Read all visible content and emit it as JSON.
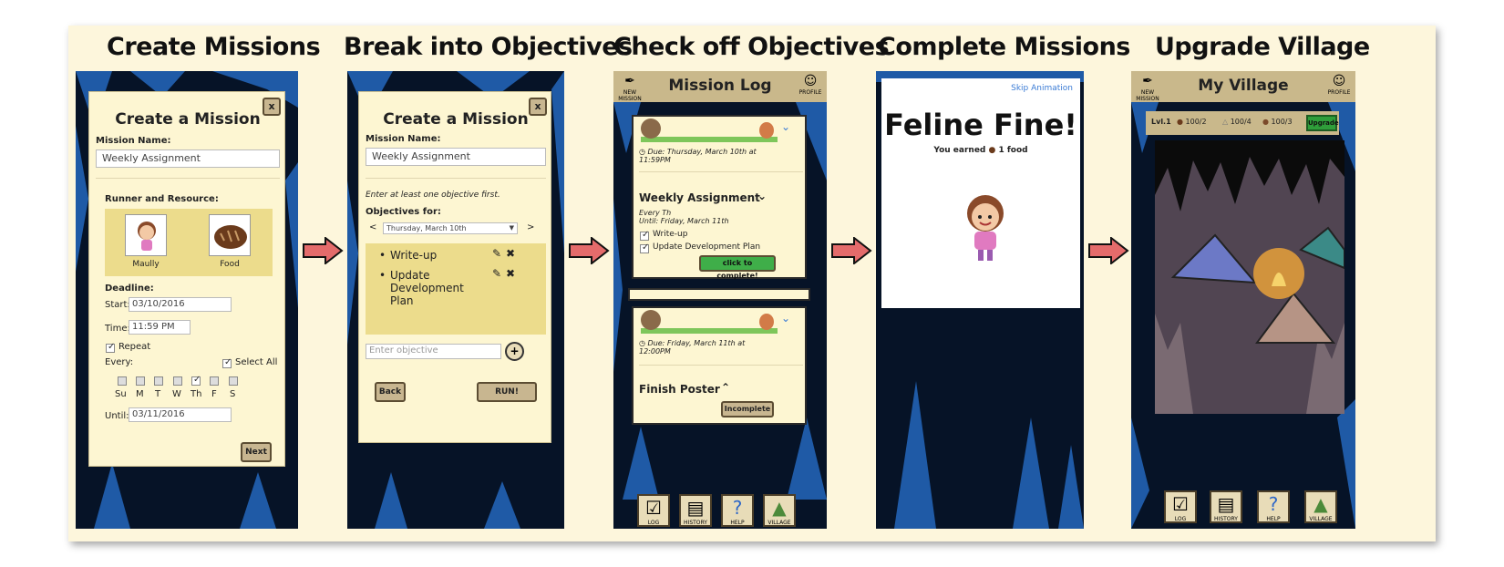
{
  "titles": [
    "Create Missions",
    "Break into Objectives",
    "Check off Objectives",
    "Complete Missions",
    "Upgrade Village"
  ],
  "create": {
    "close": "x",
    "heading": "Create a Mission",
    "mission_name_label": "Mission Name:",
    "mission_name_value": "Weekly Assignment",
    "runner_label": "Runner and Resource:",
    "runner_name": "Maully",
    "resource_name": "Food",
    "deadline_label": "Deadline:",
    "start_label": "Start:",
    "start_value": "03/10/2016",
    "time_label": "Time:",
    "time_value": "11:59 PM",
    "repeat_label": "Repeat",
    "every_label": "Every:",
    "select_all_label": "Select All",
    "days": [
      "Su",
      "M",
      "T",
      "W",
      "Th",
      "F",
      "S"
    ],
    "until_label": "Until:",
    "until_value": "03/11/2016",
    "next_label": "Next"
  },
  "objectives": {
    "close": "x",
    "heading": "Create a Mission",
    "mission_name_label": "Mission Name:",
    "mission_name_value": "Weekly Assignment",
    "hint": "Enter at least one objective first.",
    "objectives_for_label": "Objectives for:",
    "prev": "<",
    "next": ">",
    "date_value": "Thursday, March 10th",
    "items": [
      "Write-up",
      "Update Development Plan"
    ],
    "input_placeholder": "Enter objective",
    "add_label": "+",
    "back_label": "Back",
    "run_label": "RUN!"
  },
  "log": {
    "new_mission_label": "NEW MISSION",
    "title": "Mission Log",
    "profile_label": "PROFILE",
    "mission1_due": "Due: Thursday, March 10th at 11:59PM",
    "mission1_name": "Weekly Assignment",
    "mission1_repeat": "Every Th",
    "mission1_until": "Until: Friday, March 11th",
    "mission1_objectives": [
      "Write-up",
      "Update Development Plan"
    ],
    "complete_label": "click to complete!",
    "mission2_due": "Due: Friday, March 11th at 12:00PM",
    "mission2_name": "Finish Poster",
    "incomplete_label": "Incomplete",
    "nav": [
      "LOG",
      "HISTORY",
      "HELP",
      "VILLAGE"
    ]
  },
  "complete": {
    "skip_label": "Skip Animation",
    "headline": "Feline Fine!",
    "earned_prefix": "You earned",
    "earned_suffix": "1 food"
  },
  "village": {
    "new_mission_label": "NEW MISSION",
    "title": "My Village",
    "profile_label": "PROFILE",
    "level": "Lvl.1",
    "food": "100/2",
    "water": "100/4",
    "wood": "100/3",
    "upgrade_label": "Upgrade",
    "nav": [
      "LOG",
      "HISTORY",
      "HELP",
      "VILLAGE"
    ]
  },
  "colors": {
    "card": "#fdf6d2",
    "highlight": "#ecdc8c",
    "complete_btn": "#3fae49",
    "upgrade_btn": "#2f9e3a",
    "arrow": "#e46b6b",
    "cave": "#1f5aa6"
  }
}
